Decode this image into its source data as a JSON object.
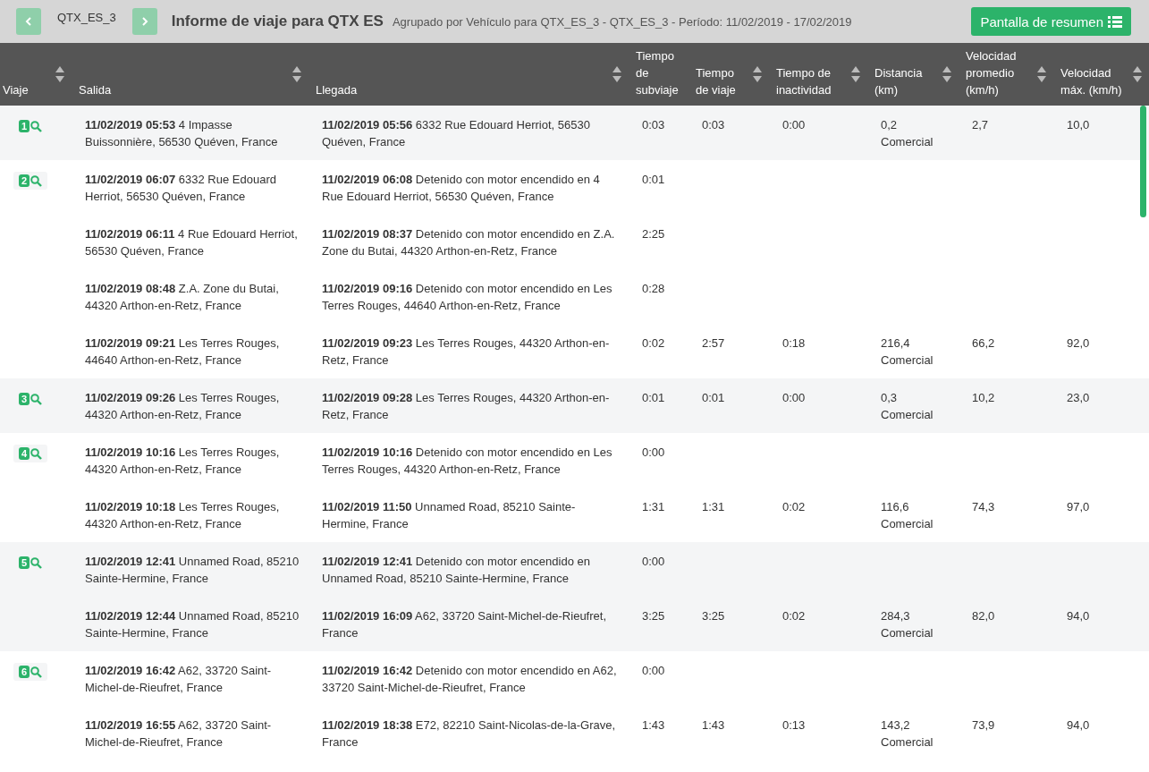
{
  "header": {
    "vehicle": "QTX_ES_3",
    "title": "Informe de viaje para QTX ES",
    "subtitle": "Agrupado por Vehículo para QTX_ES_3 - QTX_ES_3 - Período: 11/02/2019  -  17/02/2019",
    "summary_button": "Pantalla de resumen"
  },
  "columns": [
    {
      "label": "Viaje",
      "sortable": true
    },
    {
      "label": "Salida",
      "sortable": true
    },
    {
      "label": "Llegada",
      "sortable": true
    },
    {
      "label": "Tiempo de subviaje",
      "sortable": false
    },
    {
      "label": "Tiempo de viaje",
      "sortable": true
    },
    {
      "label": "Tiempo de inactividad",
      "sortable": true
    },
    {
      "label": "Distancia (km)",
      "sortable": true
    },
    {
      "label": "Velocidad promedio (km/h)",
      "sortable": true
    },
    {
      "label": "Velocidad máx. (km/h)",
      "sortable": true
    }
  ],
  "trips": [
    {
      "number": "1",
      "segments": [
        {
          "departure": "**11/02/2019 05:53** 4 Impasse Buissonnière, 56530 Quéven, France",
          "arrival": "**11/02/2019 05:56** 6332 Rue Edouard Herriot, 56530 Quéven, France",
          "subtrip_time": "0:03"
        }
      ],
      "trip_time": "0:03",
      "idle_time": "0:00",
      "distance": "0,2",
      "distance_type": "Comercial",
      "avg_speed": "2,7",
      "max_speed": "10,0"
    },
    {
      "number": "2",
      "segments": [
        {
          "departure": "**11/02/2019 06:07** 6332 Rue Edouard Herriot, 56530 Quéven, France",
          "arrival": "**11/02/2019 06:08** Detenido con motor encendido en 4 Rue Edouard Herriot, 56530 Quéven, France",
          "subtrip_time": "0:01"
        },
        {
          "departure": "**11/02/2019 06:11** 4 Rue Edouard Herriot, 56530 Quéven, France",
          "arrival": "**11/02/2019 08:37** Detenido con motor encendido en Z.A. Zone du Butai, 44320 Arthon-en-Retz, France",
          "subtrip_time": "2:25"
        },
        {
          "departure": "**11/02/2019 08:48** Z.A. Zone du Butai, 44320 Arthon-en-Retz, France",
          "arrival": "**11/02/2019 09:16** Detenido con motor encendido en Les Terres Rouges, 44640 Arthon-en-Retz, France",
          "subtrip_time": "0:28"
        },
        {
          "departure": "**11/02/2019 09:21** Les Terres Rouges, 44640 Arthon-en-Retz, France",
          "arrival": "**11/02/2019 09:23** Les Terres Rouges, 44320 Arthon-en-Retz, France",
          "subtrip_time": "0:02"
        }
      ],
      "trip_time": "2:57",
      "idle_time": "0:18",
      "distance": "216,4",
      "distance_type": "Comercial",
      "avg_speed": "66,2",
      "max_speed": "92,0"
    },
    {
      "number": "3",
      "segments": [
        {
          "departure": "**11/02/2019 09:26** Les Terres Rouges, 44320 Arthon-en-Retz, France",
          "arrival": "**11/02/2019 09:28** Les Terres Rouges, 44320 Arthon-en-Retz, France",
          "subtrip_time": "0:01"
        }
      ],
      "trip_time": "0:01",
      "idle_time": "0:00",
      "distance": "0,3",
      "distance_type": "Comercial",
      "avg_speed": "10,2",
      "max_speed": "23,0"
    },
    {
      "number": "4",
      "segments": [
        {
          "departure": "**11/02/2019 10:16** Les Terres Rouges, 44320 Arthon-en-Retz, France",
          "arrival": "**11/02/2019 10:16** Detenido con motor encendido en Les Terres Rouges, 44320 Arthon-en-Retz, France",
          "subtrip_time": "0:00"
        },
        {
          "departure": "**11/02/2019 10:18** Les Terres Rouges, 44320 Arthon-en-Retz, France",
          "arrival": "**11/02/2019 11:50** Unnamed Road, 85210 Sainte-Hermine, France",
          "subtrip_time": "1:31"
        }
      ],
      "trip_time": "1:31",
      "idle_time": "0:02",
      "distance": "116,6",
      "distance_type": "Comercial",
      "avg_speed": "74,3",
      "max_speed": "97,0"
    },
    {
      "number": "5",
      "segments": [
        {
          "departure": "**11/02/2019 12:41** Unnamed Road, 85210 Sainte-Hermine, France",
          "arrival": "**11/02/2019 12:41** Detenido con motor encendido en Unnamed Road, 85210 Sainte-Hermine, France",
          "subtrip_time": "0:00"
        },
        {
          "departure": "**11/02/2019 12:44** Unnamed Road, 85210 Sainte-Hermine, France",
          "arrival": "**11/02/2019 16:09** A62, 33720 Saint-Michel-de-Rieufret, France",
          "subtrip_time": "3:25"
        }
      ],
      "trip_time": "3:25",
      "idle_time": "0:02",
      "distance": "284,3",
      "distance_type": "Comercial",
      "avg_speed": "82,0",
      "max_speed": "94,0"
    },
    {
      "number": "6",
      "segments": [
        {
          "departure": "**11/02/2019 16:42** A62, 33720 Saint-Michel-de-Rieufret, France",
          "arrival": "**11/02/2019 16:42** Detenido con motor encendido en A62, 33720 Saint-Michel-de-Rieufret, France",
          "subtrip_time": "0:00"
        },
        {
          "departure": "**11/02/2019 16:55** A62, 33720 Saint-Michel-de-Rieufret, France",
          "arrival": "**11/02/2019 18:38** E72, 82210 Saint-Nicolas-de-la-Grave, France",
          "subtrip_time": "1:43"
        }
      ],
      "trip_time": "1:43",
      "idle_time": "0:13",
      "distance": "143,2",
      "distance_type": "Comercial",
      "avg_speed": "73,9",
      "max_speed": "94,0"
    }
  ]
}
